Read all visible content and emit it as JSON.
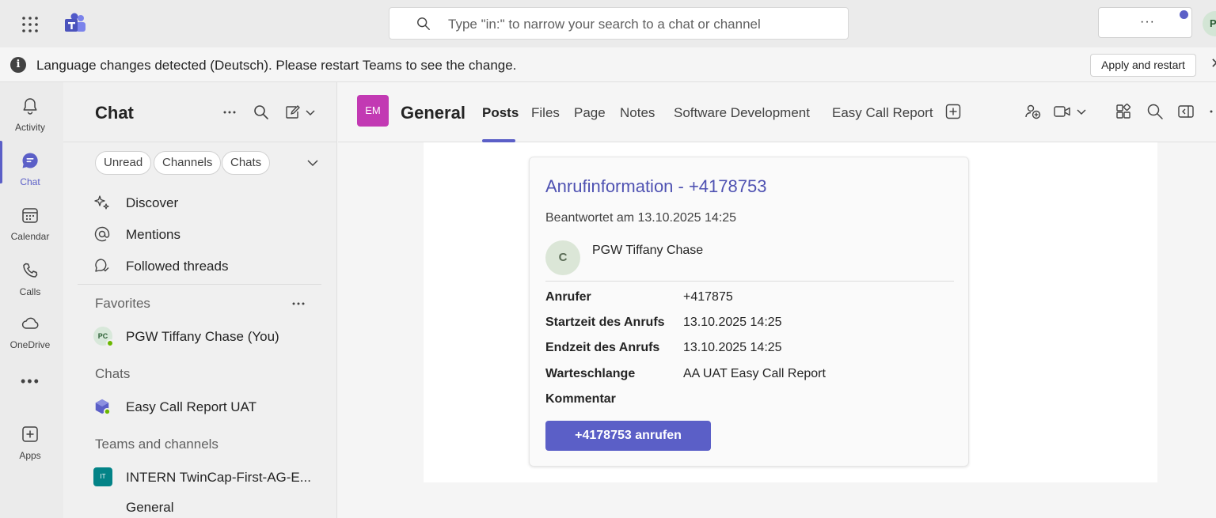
{
  "titlebar": {
    "search_placeholder": "Type \"in:\" to narrow your search to a chat or channel",
    "more_label": "···",
    "profile_initial": "P",
    "icons": [
      "app-launcher-icon",
      "teams-logo-icon",
      "search-icon"
    ]
  },
  "banner": {
    "message": "Language changes detected (Deutsch). Please restart Teams to see the change.",
    "info_glyph": "i",
    "apply_label": "Apply and restart",
    "close_glyph": "✕"
  },
  "rail": {
    "items": [
      {
        "label": "Activity",
        "icon": "bell-icon"
      },
      {
        "label": "Chat",
        "icon": "chat-icon"
      },
      {
        "label": "Calendar",
        "icon": "calendar-icon"
      },
      {
        "label": "Calls",
        "icon": "phone-icon"
      },
      {
        "label": "OneDrive",
        "icon": "cloud-icon"
      },
      {
        "label": "Apps",
        "icon": "add-app-icon"
      }
    ],
    "more_glyph": "•••"
  },
  "chatlist": {
    "title": "Chat",
    "filters": [
      "Unread",
      "Channels",
      "Chats"
    ],
    "nav": [
      {
        "label": "Discover",
        "icon": "sparkle-icon"
      },
      {
        "label": "Mentions",
        "icon": "at-icon"
      },
      {
        "label": "Followed threads",
        "icon": "followed-threads-icon"
      }
    ],
    "favorites_header": "Favorites",
    "favorites": [
      {
        "label": "PGW Tiffany Chase (You)",
        "initials": "PC"
      }
    ],
    "chats_header": "Chats",
    "chats": [
      {
        "label": "Easy Call Report UAT"
      }
    ],
    "teams_header": "Teams and channels",
    "teams": [
      {
        "label": "INTERN TwinCap-First-AG-E...",
        "initials": "IT"
      }
    ],
    "channels": [
      {
        "label": "General"
      }
    ]
  },
  "channel": {
    "avatar": "EM",
    "name": "General",
    "tabs": [
      "Posts",
      "Files",
      "Page",
      "Notes",
      "Software Development",
      "Easy Call Report"
    ],
    "active_tab": "Posts"
  },
  "card": {
    "title": "Anrufinformation - +4178753",
    "answered": "Beantwortet am 13.10.2025 14:25",
    "agent_initial": "C",
    "agent_name": "PGW Tiffany Chase",
    "facts": [
      {
        "key": "Anrufer",
        "value": "+417875"
      },
      {
        "key": "Startzeit des Anrufs",
        "value": "13.10.2025 14:25"
      },
      {
        "key": "Endzeit des Anrufs",
        "value": "13.10.2025 14:25"
      },
      {
        "key": "Warteschlange",
        "value": "AA UAT Easy Call Report"
      },
      {
        "key": "Kommentar",
        "value": ""
      }
    ],
    "call_button": "+4178753 anrufen"
  },
  "colors": {
    "brand": "#5b5fc7",
    "title_link": "#4f52b2",
    "channel_avatar": "#c239b3",
    "team_avatar": "#038387",
    "presence": "#6bb700"
  }
}
